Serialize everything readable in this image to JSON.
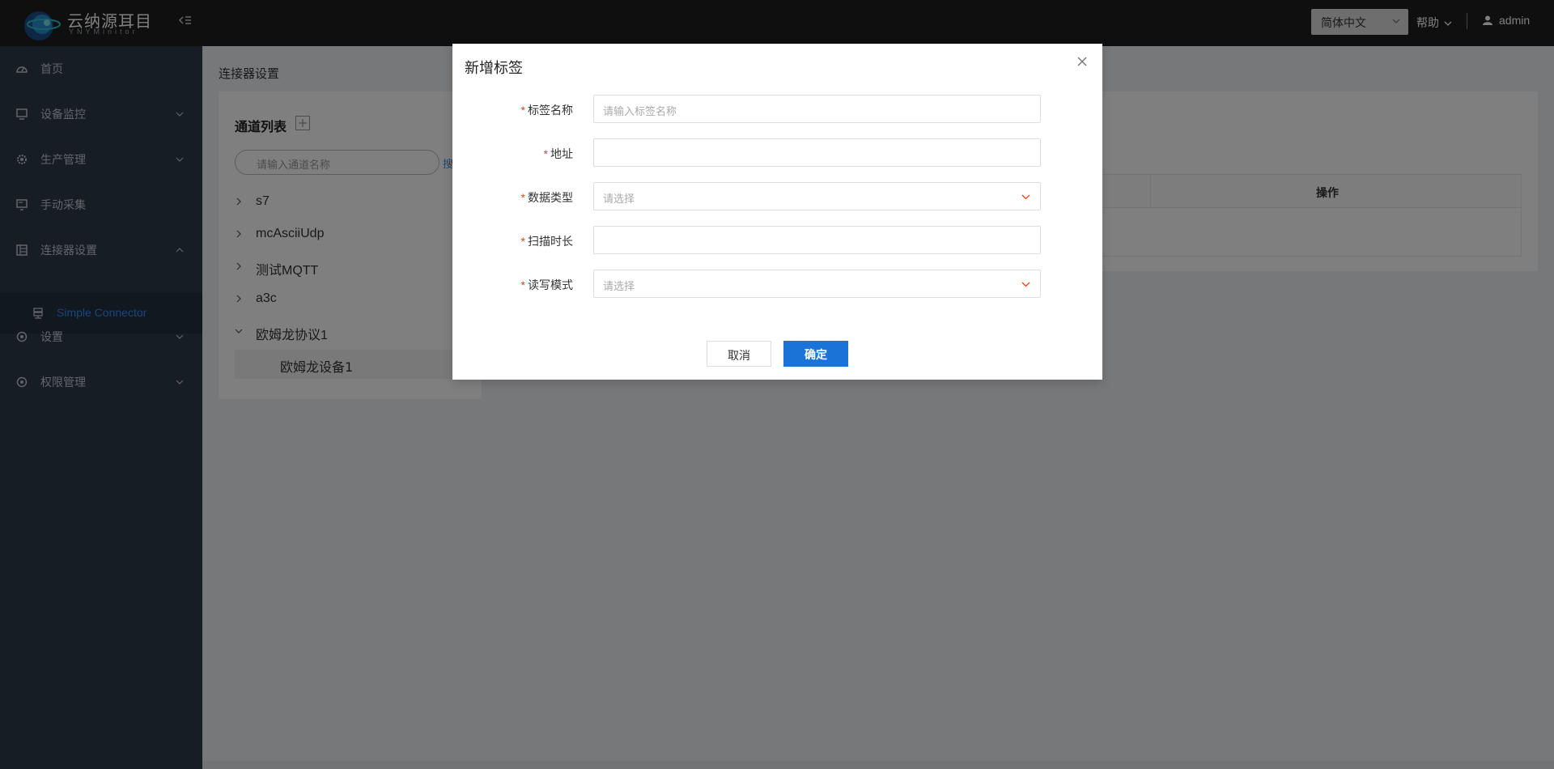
{
  "header": {
    "brand_title": "云纳源耳目",
    "brand_subtitle": "YNYMinitor",
    "language": "简体中文",
    "help": "帮助",
    "user": "admin"
  },
  "sidebar": {
    "items": [
      {
        "label": "首页",
        "icon": "dashboard-icon"
      },
      {
        "label": "设备监控",
        "icon": "monitor-icon"
      },
      {
        "label": "生产管理",
        "icon": "gear-icon"
      },
      {
        "label": "手动采集",
        "icon": "screen-icon"
      },
      {
        "label": "连接器设置",
        "icon": "table-icon"
      },
      {
        "label": "设置",
        "icon": "settings-icon"
      },
      {
        "label": "权限管理",
        "icon": "lock-icon"
      }
    ],
    "active_sub": {
      "label": "Simple Connector",
      "icon": "server-icon"
    }
  },
  "main": {
    "breadcrumb": "连接器设置",
    "channel_title": "通道列表",
    "search_placeholder": "请输入通道名称",
    "search_link": "搜",
    "tree": [
      "s7",
      "mcAsciiUdp",
      "测试MQTT",
      "a3c",
      "欧姆龙协议1"
    ],
    "tree_child": "欧姆龙设备1",
    "table_op_header": "操作"
  },
  "modal": {
    "title": "新增标签",
    "fields": [
      {
        "label": "标签名称",
        "placeholder": "请输入标签名称",
        "type": "input"
      },
      {
        "label": "地址",
        "placeholder": "",
        "type": "input"
      },
      {
        "label": "数据类型",
        "placeholder": "请选择",
        "type": "select"
      },
      {
        "label": "扫描时长",
        "placeholder": "",
        "type": "input"
      },
      {
        "label": "读写模式",
        "placeholder": "请选择",
        "type": "select"
      }
    ],
    "cancel": "取消",
    "ok": "确定"
  },
  "colors": {
    "header_bg": "#1f1f1f",
    "sidebar_bg": "#2d3a4a",
    "accent": "#2f8cf0",
    "primary_button": "#1a73d6",
    "required": "#ed4014"
  }
}
